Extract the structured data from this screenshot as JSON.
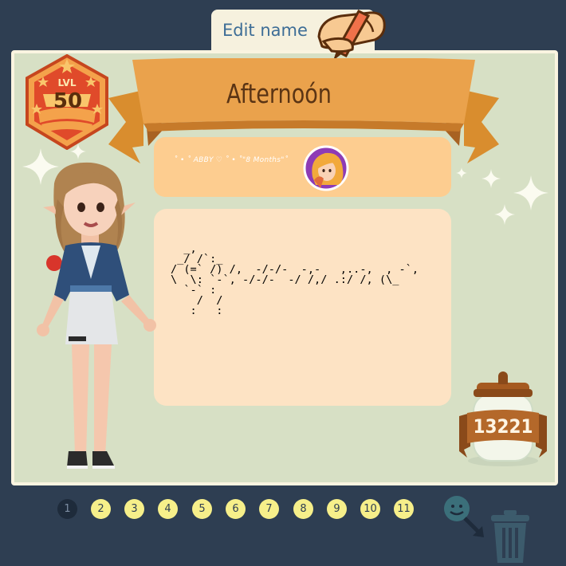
{
  "header": {
    "edit_label": "Edit name"
  },
  "profile": {
    "level_label": "LVL",
    "level": "50",
    "name": "Afternoón",
    "best_friend_text": "˚ • ˚ ABBY ♡ ˚ • ˚\"8 Months\"˚",
    "bio_lines": [
      "  _,",
      " _/ /`:_",
      "/ (=` /) /,  -/-/-  -,-   ,..-,  , -`,",
      "\\  \\: `-`, -/-/-  -/ /,/ .:/ /, (\\_",
      "  `-` :",
      "    /  /",
      "   :   :"
    ],
    "coins": "13221"
  },
  "pager": {
    "pages": [
      "1",
      "2",
      "3",
      "4",
      "5",
      "6",
      "7",
      "8",
      "9",
      "10",
      "11"
    ],
    "active": "1"
  },
  "colors": {
    "background": "#2e3e52",
    "panel": "#d7e0c5",
    "ribbon": "#eaa24c",
    "friend_card": "#fdcd90",
    "bio_card": "#fde3c4",
    "page_dot": "#f6ef8a"
  },
  "icons": [
    "pencil-hand-icon",
    "level-badge-icon",
    "friend-avatar-icon",
    "cookie-jar-icon",
    "sparkle-icon",
    "smiley-drag-icon",
    "trash-icon"
  ]
}
